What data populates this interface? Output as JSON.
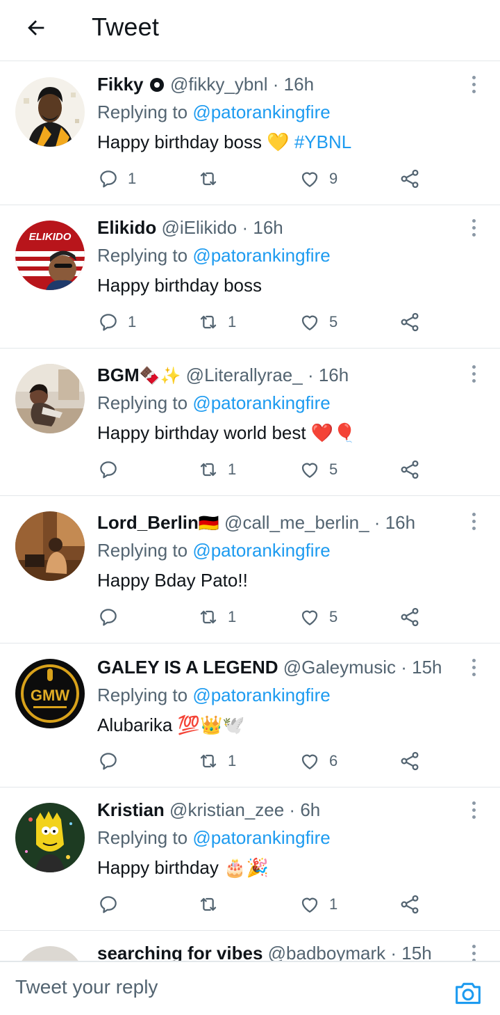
{
  "header": {
    "title": "Tweet",
    "back_icon": "arrow-left-icon"
  },
  "colors": {
    "accent": "#1d9bf0",
    "text": "#0f1419",
    "muted": "#536471",
    "divider": "#e3e7ea"
  },
  "replies": [
    {
      "name": "Fikky",
      "handle": "@fikky_ybnl",
      "sep": "·",
      "time": "16h",
      "replying_prefix": "Replying to ",
      "replying_to": "@patorankingfire",
      "text": "Happy birthday boss ",
      "text_emoji": "💛",
      "hashtag": " #YBNL",
      "counts": {
        "reply": "1",
        "retweet": "",
        "like": "9"
      }
    },
    {
      "name": "Elikido",
      "handle": "@iElikido",
      "sep": "·",
      "time": "16h",
      "replying_prefix": "Replying to ",
      "replying_to": "@patorankingfire",
      "text": "Happy birthday boss",
      "counts": {
        "reply": "1",
        "retweet": "1",
        "like": "5"
      },
      "avatar_text": "ELIKIDO"
    },
    {
      "name": "BGM",
      "name_emoji": "🍫✨",
      "handle": "@Literallyrae_",
      "sep": "·",
      "time": "16h",
      "replying_prefix": "Replying to ",
      "replying_to": "@patorankingfire",
      "text": "Happy birthday world best ",
      "text_emoji": "❤️🎈",
      "counts": {
        "reply": "",
        "retweet": "1",
        "like": "5"
      }
    },
    {
      "name": "Lord_Berlin",
      "name_emoji": "🇩🇪",
      "handle": "@call_me_berlin_",
      "sep": "·",
      "time": "16h",
      "replying_prefix": "Replying to ",
      "replying_to": "@patorankingfire",
      "text": "Happy Bday Pato!!",
      "counts": {
        "reply": "",
        "retweet": "1",
        "like": "5"
      }
    },
    {
      "name": "GALEY IS A LEGEND",
      "handle": "@Galeymusic",
      "sep": "·",
      "time": "15h",
      "replying_prefix": "Replying to ",
      "replying_to": "@patorankingfire",
      "text": "Alubarika ",
      "text_emoji": "💯👑🕊️",
      "counts": {
        "reply": "",
        "retweet": "1",
        "like": "6"
      },
      "avatar_text": "GMW"
    },
    {
      "name": "Kristian",
      "handle": "@kristian_zee",
      "sep": "·",
      "time": "6h",
      "replying_prefix": "Replying to ",
      "replying_to": "@patorankingfire",
      "text": "Happy birthday ",
      "text_emoji": "🎂🎉",
      "counts": {
        "reply": "",
        "retweet": "",
        "like": "1"
      }
    },
    {
      "name": "searching for vibes",
      "handle": "@badboymark",
      "sep": "·",
      "time": "15h"
    }
  ],
  "reply_bar": {
    "placeholder": "Tweet your reply",
    "camera_icon": "camera-icon"
  }
}
